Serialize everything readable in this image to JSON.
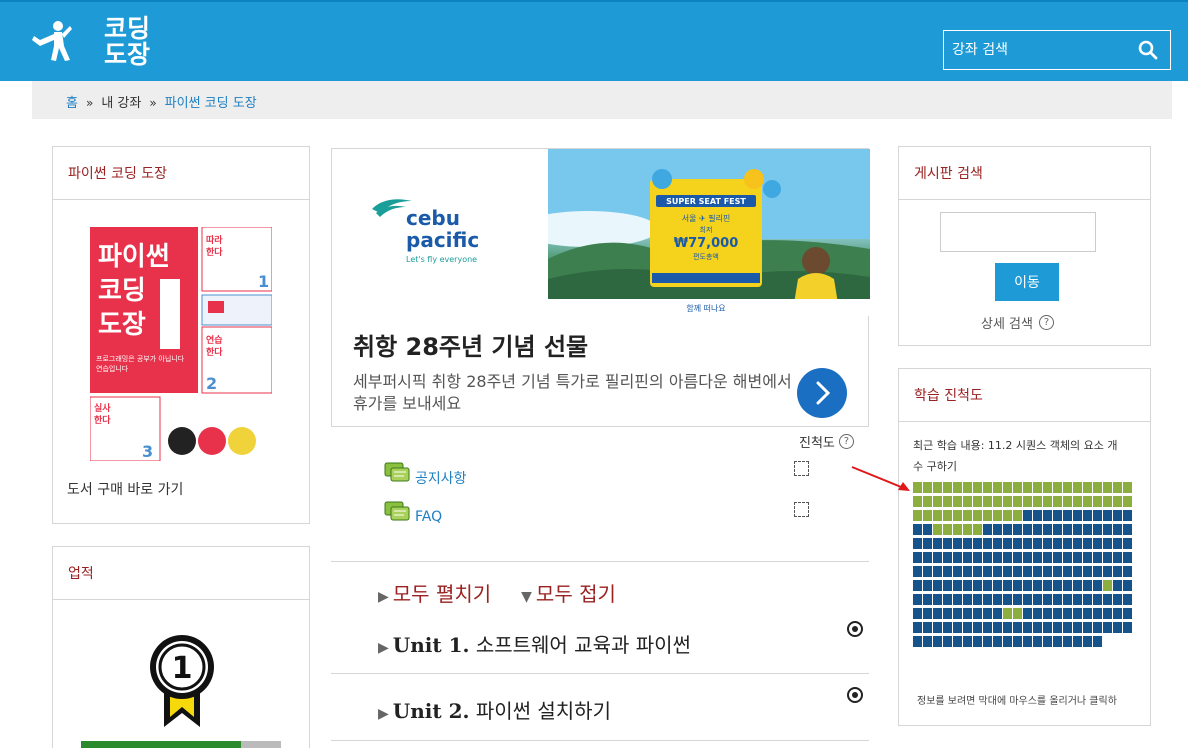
{
  "header": {
    "logo_text_line1": "코딩",
    "logo_text_line2": "도장",
    "search_placeholder": "강좌 검색",
    "search_icon": "search-icon"
  },
  "breadcrumb": {
    "items": [
      "홈",
      "내 강좌",
      "파이썬 코딩 도장"
    ],
    "separator": "»"
  },
  "left": {
    "course_block_title": "파이썬 코딩 도장",
    "book_link": "도서 구매 바로 가기",
    "achievements_title": "업적",
    "achievement_level": "1",
    "achievement_progress": 0.8
  },
  "ad": {
    "brand_line1": "cebu",
    "brand_line2": "pacific",
    "brand_tagline": "Let's fly everyone",
    "banner_fest": "SUPER SEAT FEST",
    "banner_route": "서울 ✈ 필리핀",
    "banner_label": "최저",
    "banner_price": "₩77,000",
    "banner_unit": "편도총액",
    "banner_cta": "함께 떠나요",
    "title": "취항 28주년 기념 선물",
    "description": "세부퍼시픽 취항 28주년 기념 특가로 필리핀의 아름다운 해변에서 휴가를 보내세요"
  },
  "main": {
    "progress_label": "진척도",
    "forums": [
      {
        "label": "공지사항"
      },
      {
        "label": "FAQ"
      }
    ],
    "expand_all": "모두 펼치기",
    "collapse_all": "모두 접기",
    "units": [
      {
        "num": "Unit 1.",
        "title": "소프트웨어 교육과 파이썬"
      },
      {
        "num": "Unit 2.",
        "title": "파이썬 설치하기"
      }
    ]
  },
  "right": {
    "forum_search_title": "게시판 검색",
    "go_button": "이동",
    "advanced_search": "상세 검색",
    "progress_title": "학습 진척도",
    "recent_label": "최근 학습 내용: 11.2 시퀀스 객체의 요소 개수 구하기",
    "grid_note": "정보를 보려면 막대에 마우스를 올리거나 클릭하",
    "grid_total_cells": 261
  },
  "colors": {
    "brand_blue": "#1e9ad6",
    "header_red": "#9a2222",
    "done_green": "#8bae3f",
    "todo_navy": "#15538a"
  }
}
